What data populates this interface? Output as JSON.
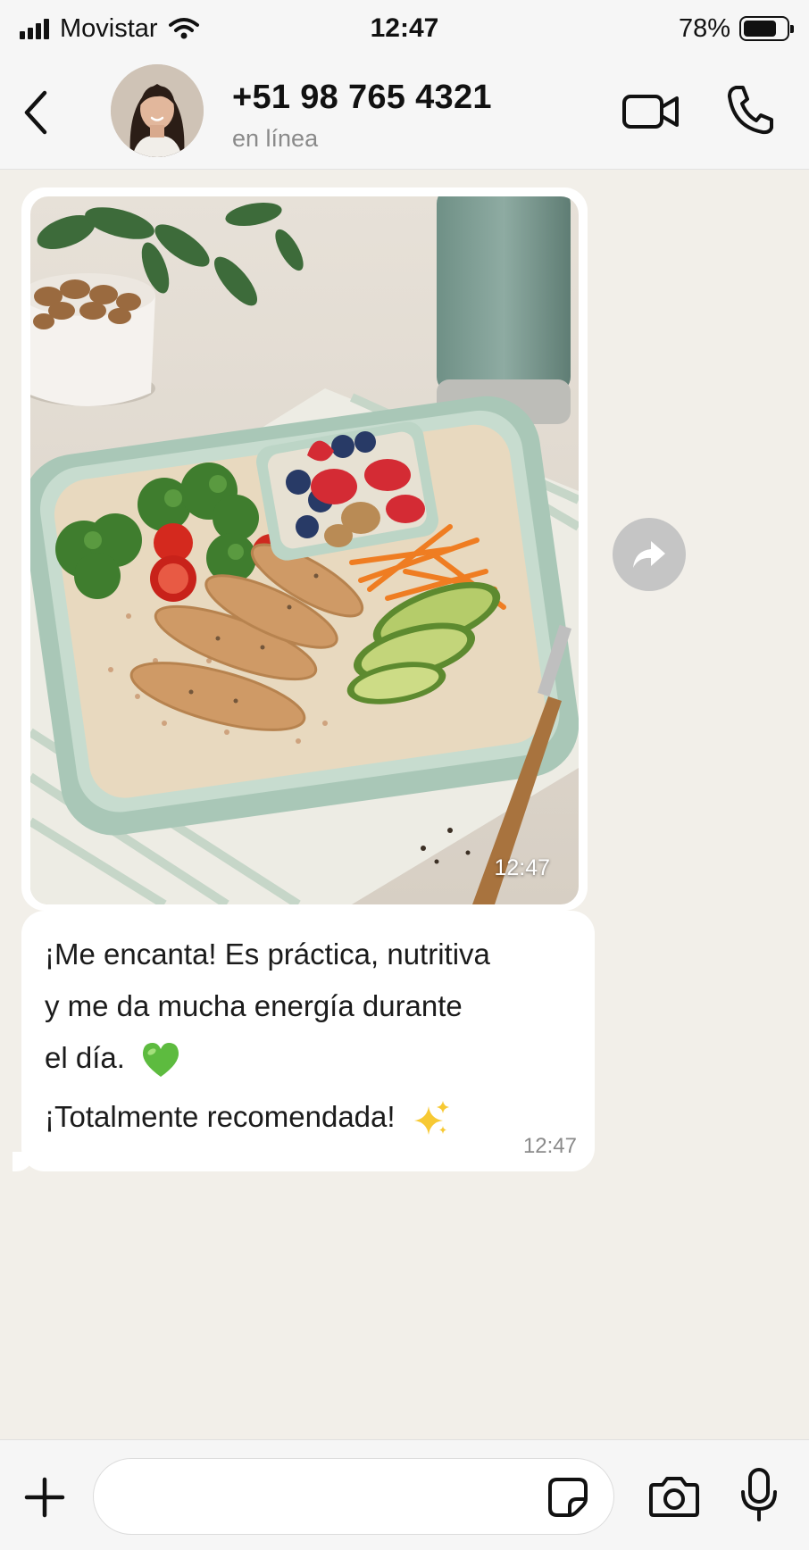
{
  "status_bar": {
    "carrier": "Movistar",
    "time": "12:47",
    "battery_percent_label": "78%",
    "battery_level": 0.78
  },
  "header": {
    "contact_name": "+51 98 765 4321",
    "status": "en línea",
    "icons": [
      "chevron-left-icon",
      "avatar",
      "video-camera-icon",
      "phone-icon"
    ]
  },
  "messages": {
    "image_message": {
      "time": "12:47"
    },
    "text_message": {
      "line1": "¡Me encanta! Es práctica, nutritiva",
      "line2": "y me da mucha energía durante",
      "line3": "el día.",
      "line4": "¡Totalmente recomendada!",
      "time": "12:47",
      "emojis": [
        "green-heart",
        "sparkles"
      ]
    }
  },
  "input_bar": {
    "placeholder": "",
    "icons": [
      "plus-icon",
      "sticker-icon",
      "camera-icon",
      "microphone-icon"
    ]
  },
  "colors": {
    "bar_background": "#f6f6f6",
    "chat_background": "#f2efe9",
    "bubble": "#ffffff",
    "secondary_text": "#8a8a8a",
    "forward_button": "#c5c5c5"
  }
}
